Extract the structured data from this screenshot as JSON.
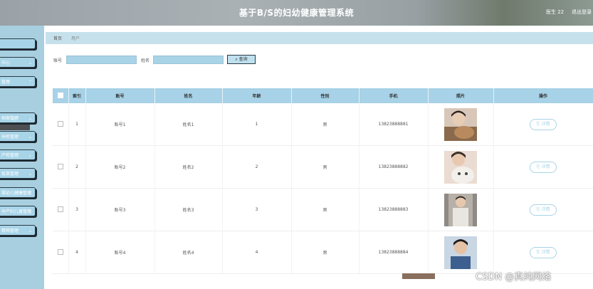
{
  "header": {
    "title": "基于B/S的妇幼健康管理系统",
    "user": "医生 22",
    "logout": "退出登录"
  },
  "sidebar": {
    "items": [
      {
        "label": ""
      },
      {
        "label": "中心"
      },
      {
        "label": "管理"
      },
      {
        "label": "档案管理"
      },
      {
        "label": "孕检管理"
      },
      {
        "label": "产检管理"
      },
      {
        "label": "疫苗管理"
      },
      {
        "label": "婴幼儿健康管理"
      },
      {
        "label": "孕产妇儿童管理"
      },
      {
        "label": "精神管理"
      }
    ],
    "submenu": "用户"
  },
  "breadcrumb": {
    "home": "首页",
    "current": "用户"
  },
  "search": {
    "account_label": "账号",
    "name_label": "姓名",
    "button": "查询"
  },
  "table": {
    "headers": [
      "",
      "索引",
      "账号",
      "姓名",
      "年龄",
      "性别",
      "手机",
      "照片",
      "操作"
    ],
    "rows": [
      {
        "index": "1",
        "account": "账号1",
        "name": "姓名1",
        "age": "1",
        "gender": "男",
        "phone": "13823888881"
      },
      {
        "index": "2",
        "account": "账号2",
        "name": "姓名2",
        "age": "2",
        "gender": "男",
        "phone": "13823888882"
      },
      {
        "index": "3",
        "account": "账号3",
        "name": "姓名3",
        "age": "3",
        "gender": "男",
        "phone": "13823888883"
      },
      {
        "index": "4",
        "account": "账号4",
        "name": "姓名4",
        "age": "4",
        "gender": "男",
        "phone": "13823888884"
      }
    ],
    "detail_label": "详情"
  },
  "watermark": "CSDN @真纯网络"
}
